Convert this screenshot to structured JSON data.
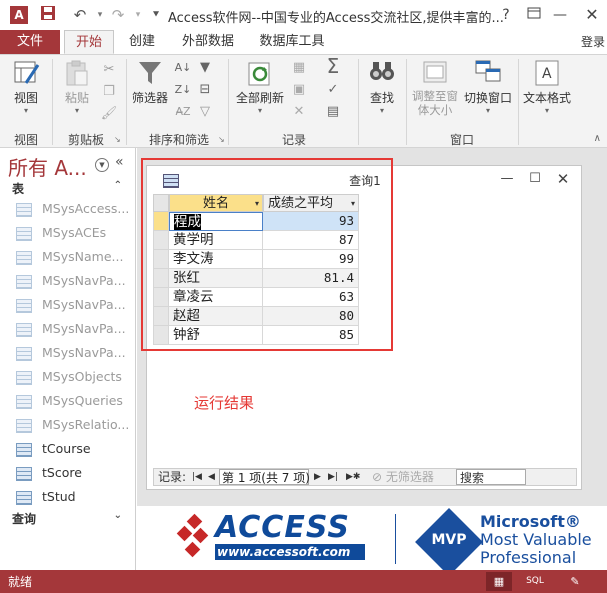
{
  "window": {
    "title": "Access软件网--中国专业的Access交流社区,提供丰富的...",
    "app_icon": "A",
    "help": "?",
    "controls": [
      "?",
      "🗗",
      "—",
      "☐",
      "✕"
    ]
  },
  "quick_access": {
    "save_icon": "save-icon",
    "undo_icon": "undo-icon",
    "redo_icon": "redo-icon",
    "customize_icon": "customize-icon"
  },
  "tabs": {
    "file": "文件",
    "items": [
      "开始",
      "创建",
      "外部数据",
      "数据库工具"
    ],
    "active": "开始",
    "login": "登录"
  },
  "ribbon": {
    "view": "视图",
    "paste": "粘贴",
    "filter": "筛选器",
    "refresh_all": "全部刷新",
    "find": "查找",
    "fit_window": "调整至窗体大小",
    "switch_window": "切换窗口",
    "text_format": "文本格式",
    "groups": [
      "视图",
      "剪贴板",
      "排序和筛选",
      "记录",
      "窗口"
    ]
  },
  "nav": {
    "header": "所有 A...",
    "section_tables": "表",
    "section_queries": "查询",
    "system_tables": [
      "MSysAccess...",
      "MSysACEs",
      "MSysName...",
      "MSysNavPa...",
      "MSysNavPa...",
      "MSysNavPa...",
      "MSysNavPa...",
      "MSysObjects",
      "MSysQueries",
      "MSysRelatio..."
    ],
    "user_tables": [
      "tCourse",
      "tScore",
      "tStud"
    ]
  },
  "query": {
    "title": "查询1",
    "columns": [
      "姓名",
      "成绩之平均"
    ],
    "rows": [
      {
        "name": "程成",
        "score": "93"
      },
      {
        "name": "黄学明",
        "score": "87"
      },
      {
        "name": "李文涛",
        "score": "99"
      },
      {
        "name": "张红",
        "score": "81.4"
      },
      {
        "name": "章凌云",
        "score": "63"
      },
      {
        "name": "赵超",
        "score": "80"
      },
      {
        "name": "钟舒",
        "score": "85"
      }
    ],
    "record_label": "记录:",
    "record_pos": "第 1 项(共 7 项)",
    "no_filter": "无筛选器",
    "search": "搜索"
  },
  "annotation": {
    "result_label": "运行结果"
  },
  "logo": {
    "access": "ACCESS",
    "url": "www.accessoft.com",
    "mvp": "MVP",
    "ms_line1": "Microsoft®",
    "ms_line2": "Most Valuable",
    "ms_line3": "Professional"
  },
  "status": {
    "text": "就绪",
    "sql": "SQL"
  },
  "colors": {
    "accent": "#a4373a",
    "annotation": "#e53935",
    "logo_blue": "#0f4a9a"
  }
}
